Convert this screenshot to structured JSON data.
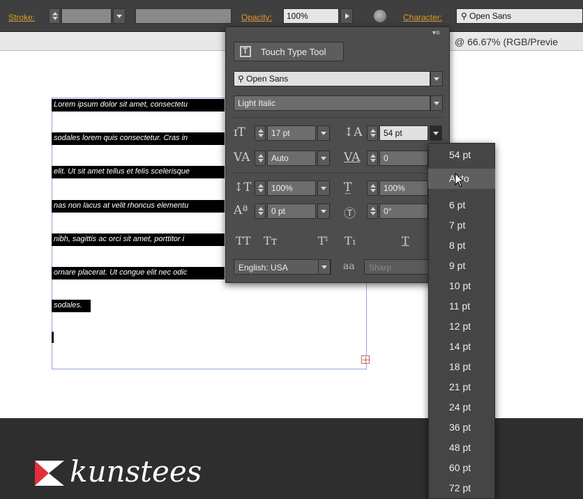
{
  "control_bar": {
    "stroke_label": "Stroke:",
    "opacity_label": "Opacity:",
    "opacity_value": "100%",
    "character_label": "Character:",
    "font_search_value": "Open Sans"
  },
  "document_tab": {
    "title": "@ 66.67% (RGB/Previe"
  },
  "canvas": {
    "text_lines": [
      "Lorem ipsum dolor sit amet, consectetu",
      "sodales lorem quis consectetur. Cras in",
      "elit. Ut sit amet tellus et felis scelerisque",
      "nas non lacus at velit rhoncus elementu",
      "nibh, sagittis ac orci sit amet, porttitor i",
      "ornare placerat. Ut congue elit nec odic",
      "sodales."
    ]
  },
  "footer": {
    "brand": "kunstees",
    "colors": {
      "logo_red": "#e0303a",
      "logo_white": "#ffffff"
    }
  },
  "character_panel": {
    "touch_type_label": "Touch Type Tool",
    "font_family": "Open Sans",
    "font_style": "Light Italic",
    "font_size": "17 pt",
    "leading": "54 pt",
    "kerning": "Auto",
    "tracking": "0",
    "vertical_scale": "100%",
    "horizontal_scale": "100%",
    "baseline_shift": "0 pt",
    "rotation": "0°",
    "language": "English: USA",
    "anti_aliasing": "Sharp"
  },
  "leading_dropdown": {
    "items": [
      "54 pt",
      "Auto",
      "6 pt",
      "7 pt",
      "8 pt",
      "9 pt",
      "10 pt",
      "11 pt",
      "12 pt",
      "14 pt",
      "18 pt",
      "21 pt",
      "24 pt",
      "36 pt",
      "48 pt",
      "60 pt",
      "72 pt"
    ],
    "hovered": "Auto"
  }
}
